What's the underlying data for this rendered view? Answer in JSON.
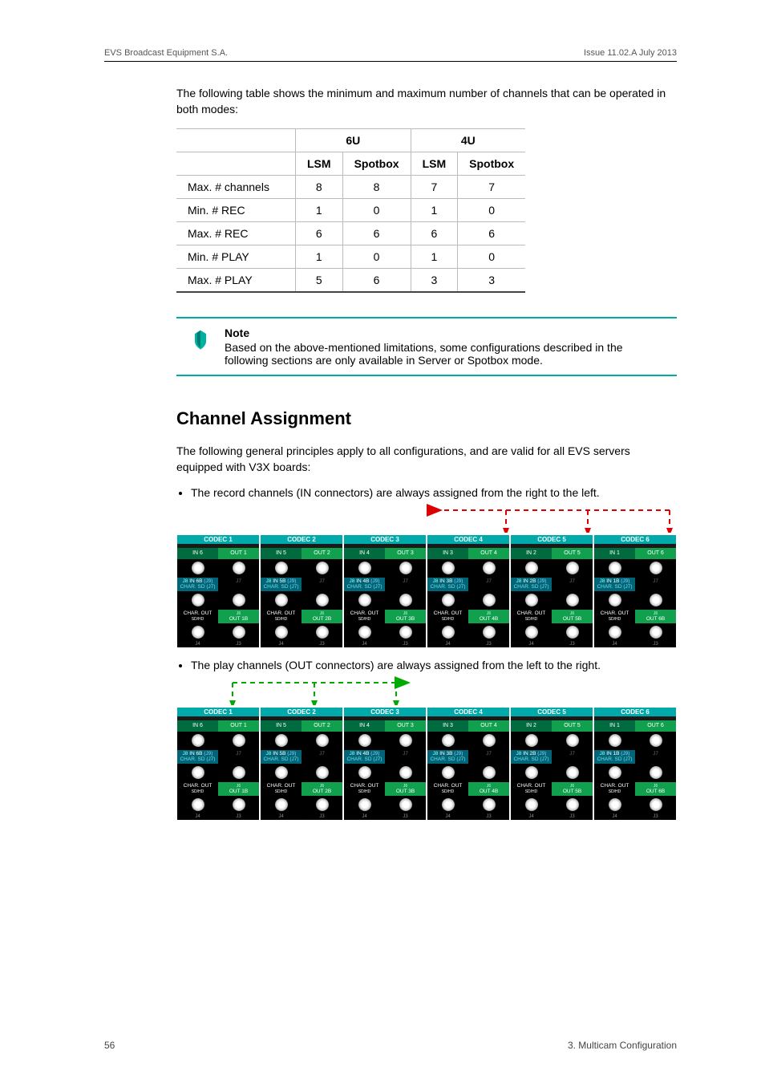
{
  "header": {
    "left": "EVS Broadcast Equipment S.A.",
    "right": "Issue 11.02.A  July 2013"
  },
  "intro_para": "The following table shows the minimum and maximum number of channels that can be operated in both modes:",
  "table": {
    "group_headers": [
      "",
      "6U",
      "4U"
    ],
    "sub_headers": [
      "",
      "LSM",
      "Spotbox",
      "LSM",
      "Spotbox"
    ],
    "rows": [
      {
        "label": "Max. # channels",
        "vals": [
          "8",
          "8",
          "7",
          "7"
        ]
      },
      {
        "label": "Min. # REC",
        "vals": [
          "1",
          "0",
          "1",
          "0"
        ]
      },
      {
        "label": "Max. # REC",
        "vals": [
          "6",
          "6",
          "6",
          "6"
        ]
      },
      {
        "label": "Min. # PLAY",
        "vals": [
          "1",
          "0",
          "1",
          "0"
        ]
      },
      {
        "label": "Max. # PLAY",
        "vals": [
          "5",
          "6",
          "3",
          "3"
        ]
      }
    ]
  },
  "note": {
    "title": "Note",
    "body": "Based on the above-mentioned limitations, some configurations described in the following sections are only available in Server or Spotbox mode."
  },
  "section_title": "Channel Assignment",
  "section_intro": "The following general principles apply to all configurations, and are valid for all EVS servers equipped with V3X boards:",
  "bullets": [
    "The record channels (IN connectors) are always assigned from the right to the left.",
    "The play channels (OUT connectors) are always assigned from the left to the right."
  ],
  "codec": {
    "modules": [
      {
        "title": "CODEC 1",
        "in": "IN 6",
        "out": "OUT 1",
        "inb": "IN 6B",
        "outb": "OUT 1B"
      },
      {
        "title": "CODEC 2",
        "in": "IN 5",
        "out": "OUT 2",
        "inb": "IN 5B",
        "outb": "OUT 2B"
      },
      {
        "title": "CODEC 3",
        "in": "IN 4",
        "out": "OUT 3",
        "inb": "IN 4B",
        "outb": "OUT 3B"
      },
      {
        "title": "CODEC 4",
        "in": "IN 3",
        "out": "OUT 4",
        "inb": "IN 3B",
        "outb": "OUT 4B"
      },
      {
        "title": "CODEC 5",
        "in": "IN 2",
        "out": "OUT 5",
        "inb": "IN 2B",
        "outb": "OUT 5B"
      },
      {
        "title": "CODEC 6",
        "in": "IN 1",
        "out": "OUT 6",
        "inb": "IN 1B",
        "outb": "OUT 6B"
      }
    ],
    "inb_sub": "(J9)",
    "char_sub": "CHAR. SD (J7)",
    "charout": "CHAR. OUT",
    "charout_sub": "SD/HD",
    "j_left": "J4",
    "j_right": "J3",
    "j8": "J8",
    "j7": "J7",
    "j6": "J6"
  },
  "footer": {
    "left": "56",
    "right": "3. Multicam Configuration"
  }
}
